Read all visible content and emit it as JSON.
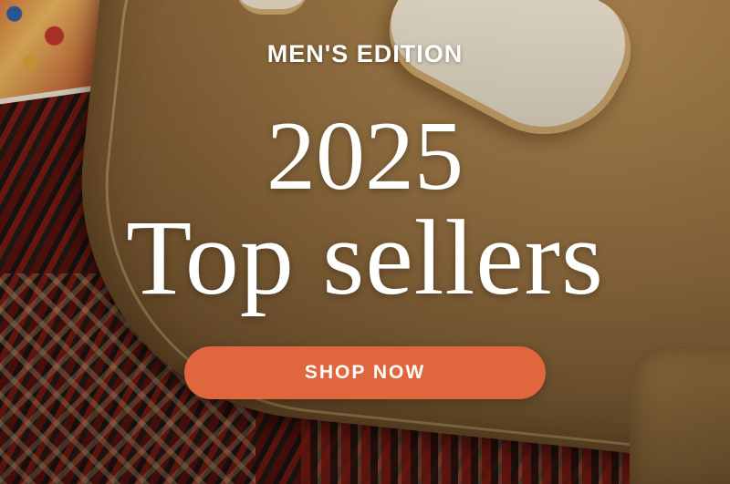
{
  "banner": {
    "eyebrow": "MEN'S EDITION",
    "year": "2025",
    "title": "Top sellers",
    "cta_label": "SHOP NOW"
  },
  "colors": {
    "cta_background": "#e0663e",
    "text": "#ffffff"
  }
}
